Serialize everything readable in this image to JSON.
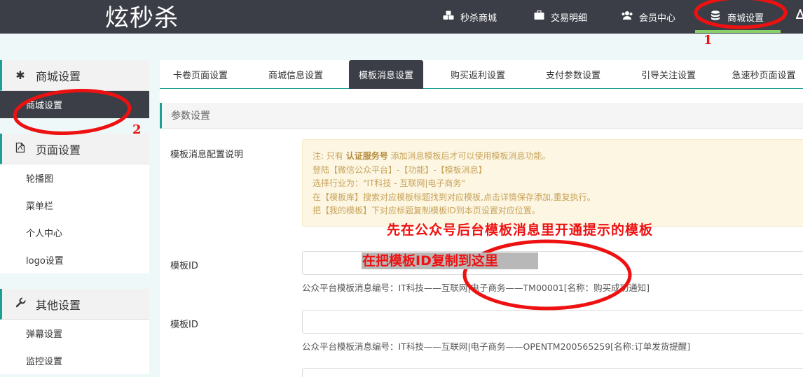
{
  "app": {
    "logo": "炫秒杀"
  },
  "topnav": [
    {
      "label": "秒杀商城",
      "icon": "cubes-icon"
    },
    {
      "label": "交易明细",
      "icon": "briefcase-icon"
    },
    {
      "label": "会员中心",
      "icon": "users-icon"
    },
    {
      "label": "商城设置",
      "icon": "database-icon",
      "active": true
    }
  ],
  "sidebar": {
    "groups": [
      {
        "title": "商城设置",
        "icon": "asterisk-icon",
        "items": [
          "商城设置"
        ],
        "active_item": "商城设置"
      },
      {
        "title": "页面设置",
        "icon": "file-icon",
        "items": [
          "轮播图",
          "菜单栏",
          "个人中心",
          "logo设置"
        ]
      },
      {
        "title": "其他设置",
        "icon": "wrench-icon",
        "items": [
          "弹幕设置",
          "监控设置"
        ]
      }
    ]
  },
  "tabs": [
    "卡卷页面设置",
    "商城信息设置",
    "模板消息设置",
    "购买返利设置",
    "支付参数设置",
    "引导关注设置",
    "急速秒页面设置"
  ],
  "active_tab": "模板消息设置",
  "section": {
    "title": "参数设置"
  },
  "form": {
    "notice_label": "模板消息配置说明",
    "notice_lines": {
      "l1_pre": "注: 只有 ",
      "l1_bold": "认证服务号",
      "l1_post": " 添加消息模板后才可以使用模板消息功能。",
      "l2": "登陆【微信公众平台】-【功能】-【模板消息】",
      "l3": "选择行业为：\"IT科技 - 互联网|电子商务\"",
      "l4": "在【模板库】搜索对应模板标题找到对应模板,点击详情保存添加,重复执行。",
      "l5": "把【我的模板】下对应标题复制模板ID到本页设置对应位置。"
    },
    "field1": {
      "label": "模板ID",
      "value": "",
      "help": "公众平台模板消息编号：IT科技——互联网|电子商务——TM00001[名称：购买成功通知]"
    },
    "field2": {
      "label": "模板ID",
      "value": "",
      "help": "公众平台模板消息编号：IT科技——互联网|电子商务——OPENTM200565259[名称:订单发货提醒]"
    }
  },
  "annotations": {
    "num1": "1",
    "num2": "2",
    "note1": "先在公众号后台模板消息里开通提示的模板",
    "note2": "在把模板ID复制到这里",
    "color": "#ee1111"
  },
  "colors": {
    "topbar": "#3b3e47",
    "accent": "#1aa094",
    "nav_active_bar": "#8ad06a",
    "notice_bg": "#fcf6e2",
    "notice_text": "#c8a35b"
  }
}
